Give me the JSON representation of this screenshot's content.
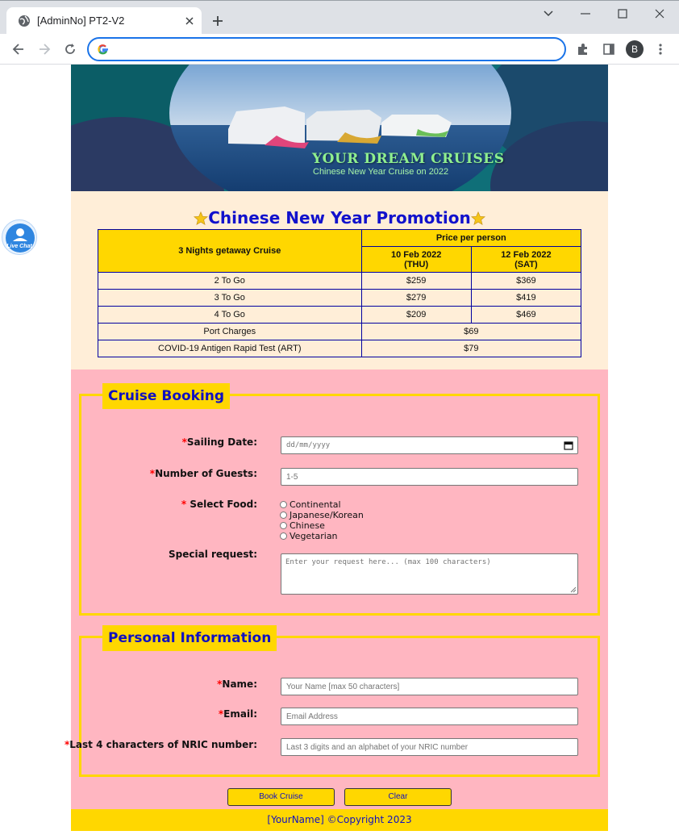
{
  "browser": {
    "tab_title": "[AdminNo] PT2-V2",
    "address_value": "",
    "profile_initial": "B"
  },
  "banner": {
    "title": "YOUR DREAM CRUISES",
    "subtitle": "Chinese New Year Cruise on 2022"
  },
  "promo": {
    "heading": "Chinese New Year Promotion",
    "table": {
      "corner_label": "3 Nights getaway Cruise",
      "price_header": "Price per person",
      "date_1": "10 Feb 2022",
      "day_1": "(THU)",
      "date_2": "12 Feb 2022",
      "day_2": "(SAT)",
      "rows": [
        {
          "label": "2 To Go",
          "p1": "$259",
          "p2": "$369"
        },
        {
          "label": "3 To Go",
          "p1": "$279",
          "p2": "$419"
        },
        {
          "label": "4 To Go",
          "p1": "$209",
          "p2": "$469"
        }
      ],
      "port_label": "Port Charges",
      "port_value": "$69",
      "art_label": "COVID-19 Antigen Rapid Test (ART)",
      "art_value": "$79"
    }
  },
  "booking": {
    "legend": "Cruise Booking",
    "required_mark": "*",
    "sailing_label": "Sailing Date:",
    "sailing_placeholder": "dd/mm/yyyy",
    "guests_label": "Number of Guests:",
    "guests_placeholder": "1-5",
    "food_label": " Select Food:",
    "food_options": [
      "Continental",
      "Japanese/Korean",
      "Chinese",
      "Vegetarian"
    ],
    "request_label": "Special request:",
    "request_placeholder": "Enter your request here... (max 100 characters)"
  },
  "personal": {
    "legend": "Personal Information",
    "name_label": "Name:",
    "name_placeholder": "Your Name [max 50 characters]",
    "email_label": "Email:",
    "email_placeholder": "Email Address",
    "nric_label": "Last 4 characters of NRIC number:",
    "nric_placeholder": "Last 3 digits and an alphabet of your NRIC number"
  },
  "buttons": {
    "book": "Book Cruise",
    "clear": "Clear"
  },
  "footer": {
    "text": "[YourName] ©Copyright 2023"
  },
  "livechat": {
    "label": "Live Chat"
  },
  "colors": {
    "gold": "#ffd700",
    "pink": "#ffb6c1",
    "cream": "#ffeed8",
    "blue_text": "#1010c0"
  }
}
